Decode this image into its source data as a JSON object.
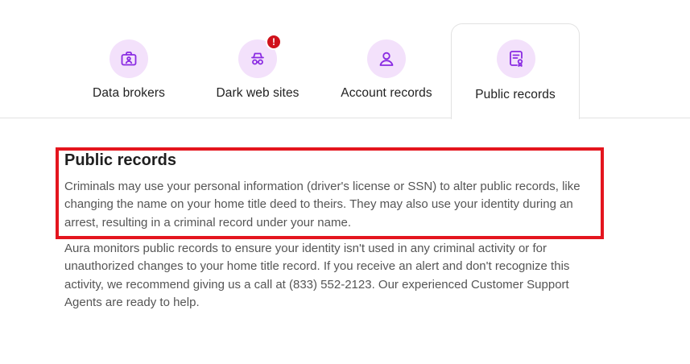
{
  "tabs": [
    {
      "label": "Data brokers",
      "icon": "briefcase-user-icon",
      "active": false
    },
    {
      "label": "Dark web sites",
      "icon": "spy-incognito-icon",
      "active": false,
      "badge": "!"
    },
    {
      "label": "Account records",
      "icon": "user-icon",
      "active": false
    },
    {
      "label": "Public records",
      "icon": "document-certificate-icon",
      "active": true
    }
  ],
  "section": {
    "title": "Public records",
    "intro": "Criminals may use your personal information (driver's license or SSN) to alter public records, like changing the name on your home title deed to theirs. They may also use your identity during an arrest, resulting in a criminal record under your name.",
    "detail": "Aura monitors public records to ensure your identity isn't used in any criminal activity or for unauthorized changes to your home title record. If you receive an alert and don't recognize this activity, we recommend giving us a call at (833) 552-2123. Our experienced Customer Support Agents are ready to help."
  },
  "colors": {
    "accent": "#8a2be2",
    "icon_bg": "#f3e1fb",
    "badge": "#d0121b",
    "highlight": "#e4151e"
  }
}
